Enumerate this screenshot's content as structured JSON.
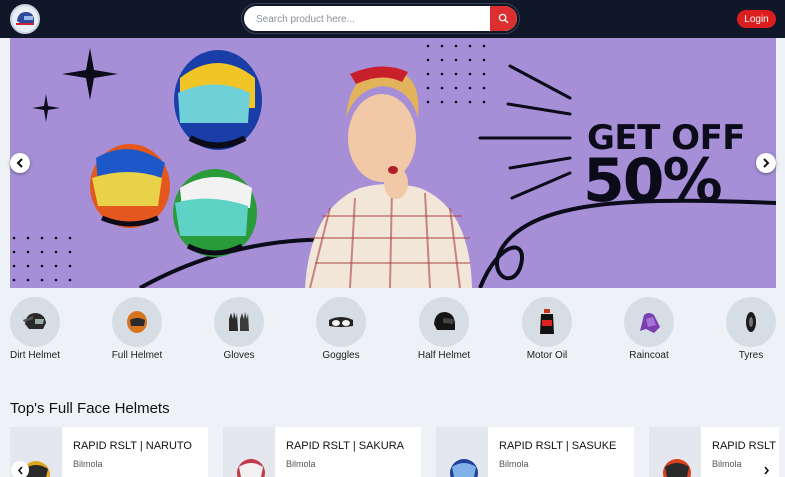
{
  "header": {
    "search_placeholder": "Search product here...",
    "login_label": "Login"
  },
  "banner": {
    "headline_line1": "GET OFF",
    "headline_line2": "50%"
  },
  "categories": [
    {
      "label": "Dirt Helmet",
      "icon": "dirt-helmet-icon"
    },
    {
      "label": "Full Helmet",
      "icon": "full-helmet-icon"
    },
    {
      "label": "Gloves",
      "icon": "gloves-icon"
    },
    {
      "label": "Goggles",
      "icon": "goggles-icon"
    },
    {
      "label": "Half Helmet",
      "icon": "half-helmet-icon"
    },
    {
      "label": "Motor Oil",
      "icon": "motor-oil-icon"
    },
    {
      "label": "Raincoat",
      "icon": "raincoat-icon"
    },
    {
      "label": "Tyres",
      "icon": "tyre-icon"
    }
  ],
  "section": {
    "title": "Top's Full Face Helmets"
  },
  "products": [
    {
      "title": "RAPID RSLT | NARUTO",
      "brand": "Bilmola"
    },
    {
      "title": "RAPID RSLT | SAKURA",
      "brand": "Bilmola"
    },
    {
      "title": "RAPID RSLT | SASUKE",
      "brand": "Bilmola"
    },
    {
      "title": "RAPID RSLT |",
      "brand": "Bilmola"
    }
  ],
  "colors": {
    "header_bg": "#0f1729",
    "accent_red": "#dc1e1e",
    "banner_bg": "#a68fd6",
    "page_bg": "#eef2f6"
  }
}
